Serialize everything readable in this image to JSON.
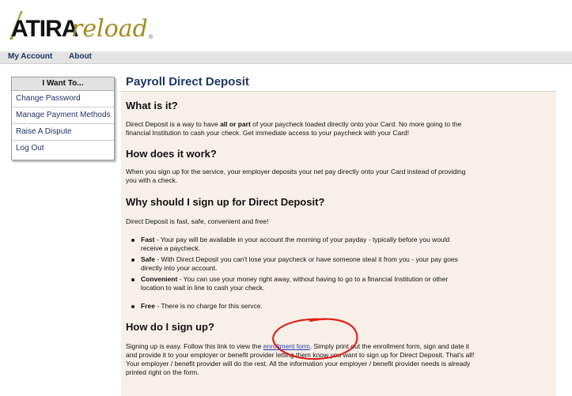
{
  "logo": {
    "atira": "ATIRA",
    "reload": "reload",
    "reg": "®"
  },
  "topnav": {
    "my_account": "My Account",
    "about": "About"
  },
  "sidebar": {
    "heading": "I Want To...",
    "items": [
      {
        "label": "Change Password"
      },
      {
        "label": "Manage Payment Methods"
      },
      {
        "label": "Raise A Dispute"
      },
      {
        "label": "Log Out"
      }
    ]
  },
  "page": {
    "title": "Payroll Direct Deposit"
  },
  "sections": {
    "what": {
      "heading": "What is it?",
      "p1_a": "Direct Deposit is a way to have ",
      "p1_bold": "all or part",
      "p1_b": " of your paycheck loaded directly onto your Card. No more going to the",
      "p1_line2": "financial Institution to cash your check. Get immediate access to your paycheck with your Card!"
    },
    "how": {
      "heading": "How does it work?",
      "line1": "When you sign up for the service, your employer deposits your net pay directly onto your Card instead of providing",
      "line2": "you with a check."
    },
    "why": {
      "heading": "Why should I sign up for Direct Deposit?",
      "intro": "Direct Deposit is fast, safe, convenient and free!",
      "bullets": [
        {
          "term": "Fast",
          "line1": " - Your pay will be available in your account the morning of your payday - typically before you would",
          "line2": "receive a paycheck."
        },
        {
          "term": "Safe",
          "line1": " - With Direct Deposit you can't lose your paycheck or have someone steal it from you - your pay goes",
          "line2": "directly into your account."
        },
        {
          "term": "Convenient",
          "line1": " - You can use your money right away, without having to go to a financial Institution or other",
          "line2": "location to wait in line to cash your check."
        },
        {
          "term": "Free",
          "line1": " - There is no charge for this servce.",
          "line2": ""
        }
      ]
    },
    "signup": {
      "heading": "How do I sign up?",
      "l1_a": "Signing up is easy. Follow this link to view the ",
      "link": "enrollment form",
      "l1_b": ". Simply print out the enrollment form, sign and date it",
      "l2": "and provide it to your employer or benefit provider letting them know you want to sign up for Direct Deposit. That's all!",
      "l3": "Your employer / benefit provider will do the rest. All the information your employer / benefit provider needs is already",
      "l4": "printed right on the form."
    }
  },
  "colors": {
    "nav_text": "#1f3564",
    "content_bg": "#f8f0e8",
    "annotation": "#e0201c",
    "reload_gold": "#a28b22"
  }
}
